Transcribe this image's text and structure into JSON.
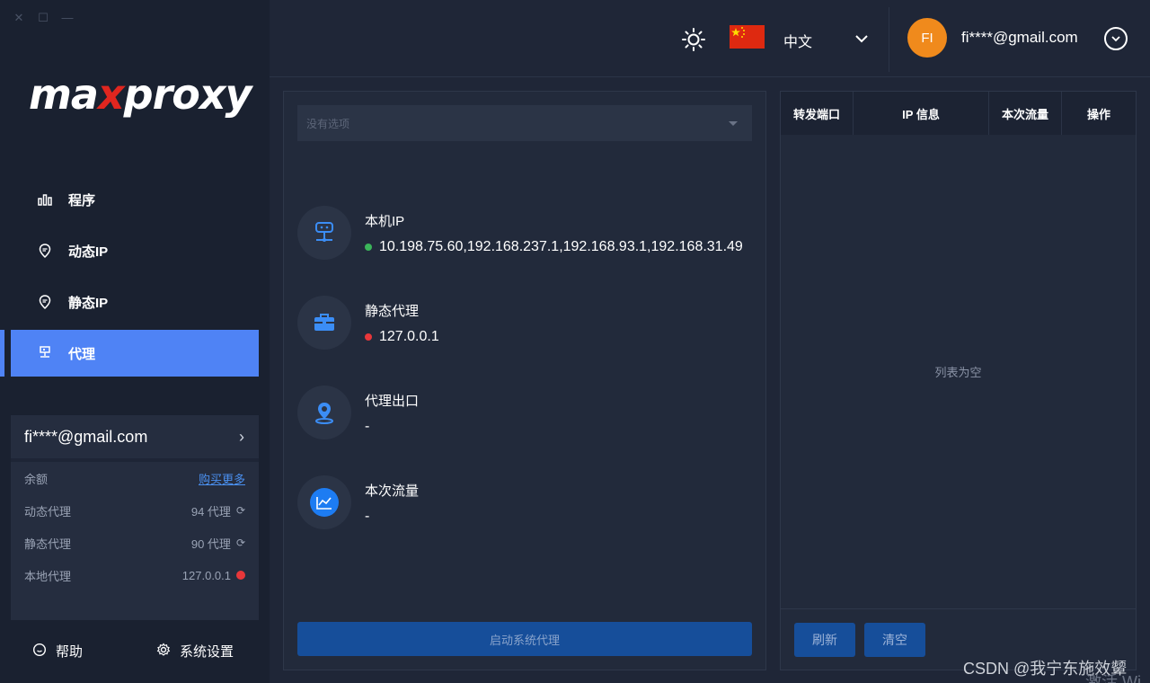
{
  "window": {
    "close": "✕",
    "maximize": "☐",
    "minimize": "—"
  },
  "logo": {
    "part1": "ma",
    "part2": "x",
    "part3": "proxy"
  },
  "nav": [
    {
      "label": "程序",
      "icon": "bar-chart-icon"
    },
    {
      "label": "动态IP",
      "icon": "location-pin-icon"
    },
    {
      "label": "静态IP",
      "icon": "location-pin-icon"
    },
    {
      "label": "代理",
      "icon": "server-icon",
      "active": true
    }
  ],
  "account": {
    "email": "fi****@gmail.com",
    "balance_label": "余额",
    "buy_more": "购买更多",
    "dynamic_label": "动态代理",
    "dynamic_value": "94 代理",
    "static_label": "静态代理",
    "static_value": "90 代理",
    "local_label": "本地代理",
    "local_value": "127.0.0.1"
  },
  "bottom": {
    "help": "帮助",
    "settings": "系统设置"
  },
  "topbar": {
    "language": "中文",
    "avatar_initials": "FI",
    "email": "fi****@gmail.com"
  },
  "main": {
    "select_placeholder": "没有选项",
    "local_ip_title": "本机IP",
    "local_ip_value": "10.198.75.60,192.168.237.1,192.168.93.1,192.168.31.49",
    "static_proxy_title": "静态代理",
    "static_proxy_value": "127.0.0.1",
    "proxy_exit_title": "代理出口",
    "proxy_exit_value": "-",
    "traffic_title": "本次流量",
    "traffic_value": "-",
    "start_button": "启动系统代理"
  },
  "table": {
    "columns": [
      "转发端口",
      "IP 信息",
      "本次流量",
      "操作"
    ],
    "empty_text": "列表为空",
    "refresh_button": "刷新",
    "clear_button": "清空"
  },
  "watermark": {
    "text": "CSDN @我宁东施效颦",
    "activate": "激活 Wi"
  },
  "colors": {
    "accent": "#4f83f5",
    "brand_red": "#e0261f",
    "avatar": "#f08a1c",
    "status_green": "#3bb55a",
    "status_red": "#e8373a"
  }
}
